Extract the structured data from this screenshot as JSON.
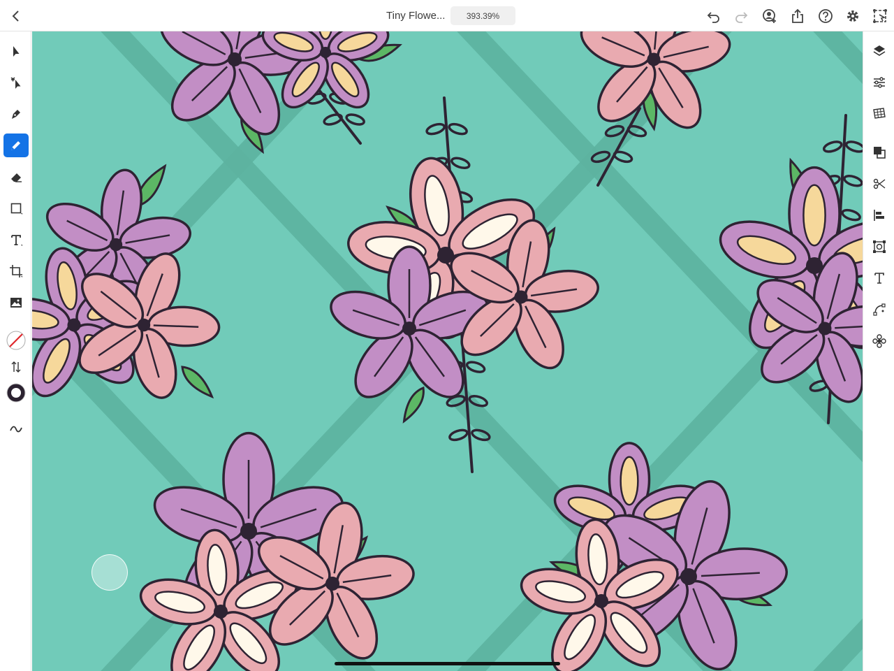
{
  "header": {
    "document_title": "Tiny Flowe...",
    "zoom_level": "393.39%"
  },
  "toolbar_icons": {
    "back": "chevron-left-icon",
    "undo": "undo-icon",
    "redo": "redo-icon",
    "invite": "add-person-icon",
    "share": "share-icon",
    "help": "help-icon",
    "settings": "gear-icon",
    "prototype": "prototype-icon"
  },
  "left_tools": [
    "selection-icon",
    "direct-selection-icon",
    "pen-icon",
    "pencil-icon",
    "eraser-icon",
    "rectangle-icon",
    "type-icon",
    "crop-icon",
    "image-icon",
    "fill-stroke-icon",
    "swap-icon",
    "stroke-color-icon",
    "smooth-icon"
  ],
  "right_tools": [
    "layers-icon",
    "properties-icon",
    "swatches-icon",
    "combine-icon",
    "cut-icon",
    "align-icon",
    "transform-icon",
    "type-properties-icon",
    "path-icon",
    "repeat-icon"
  ],
  "colors": {
    "accent": "#1473e6",
    "canvas_bg": "#71cbb9",
    "stripe": "#5db3a0",
    "petal_purple": "#c28ec5",
    "petal_pink": "#e9aab0",
    "petal_yellow": "#f6d89b",
    "petal_cream": "#fff8ea",
    "leaf_green": "#5cb765",
    "outline": "#2e2333"
  }
}
